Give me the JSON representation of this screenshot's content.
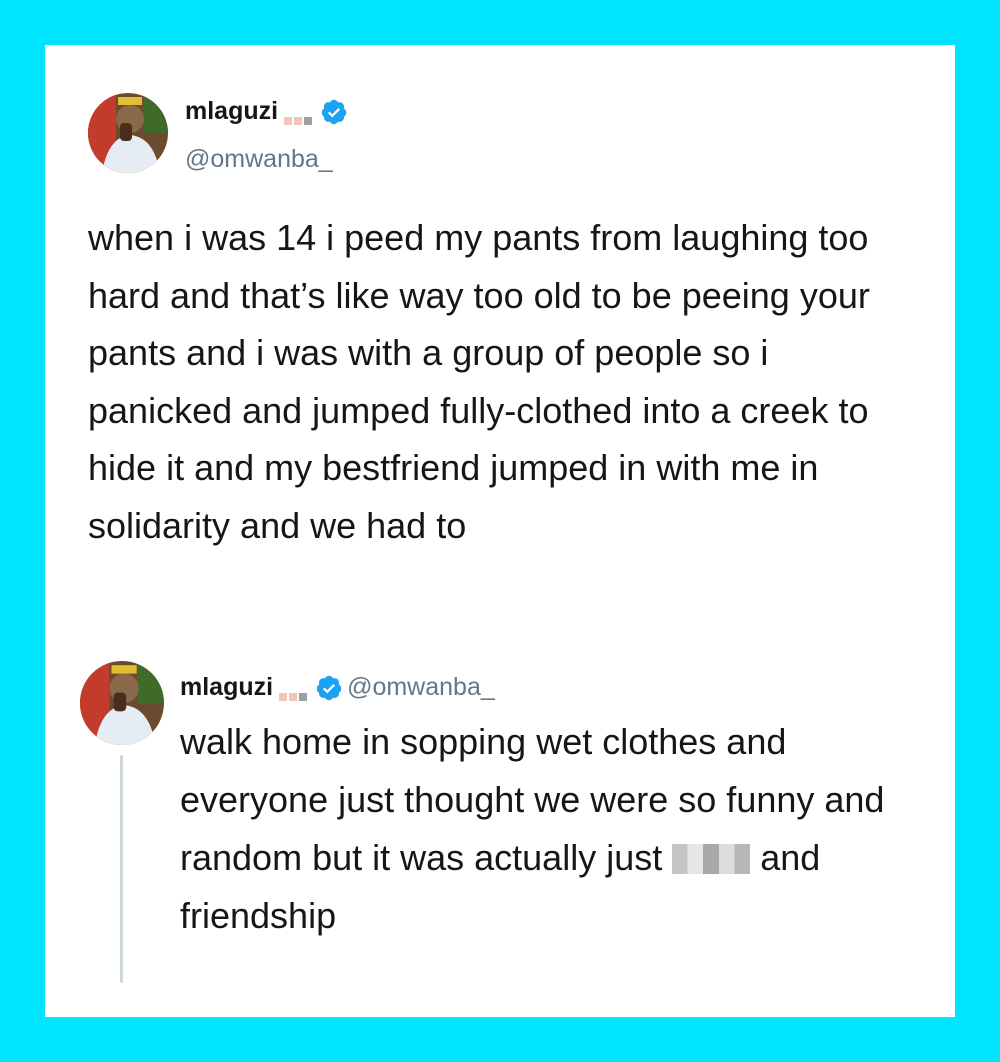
{
  "tweet": {
    "author_name": "mlaguzi",
    "author_handle": "@omwanba_",
    "text": "when i was 14 i peed my pants from laughing too hard and that’s like way too old to be peeing your pants and i was with a group of people so i panicked and jumped fully-clothed into a creek to hide it and my bestfriend jumped in with me in solidarity and we had to"
  },
  "reply": {
    "author_name": "mlaguzi",
    "author_handle": "@omwanba_",
    "text_before_censor": "walk home in sopping wet clothes and everyone just thought we were so funny and random but it was actually just ",
    "text_after_censor": " and friendship"
  },
  "icons": {
    "verified": "verified-badge-icon",
    "emoji": "emoji-icon"
  },
  "colors": {
    "frame": "#00e5ff",
    "card": "#ffffff",
    "verified_blue": "#1da1f2",
    "text": "#14171a",
    "handle": "#657786"
  }
}
